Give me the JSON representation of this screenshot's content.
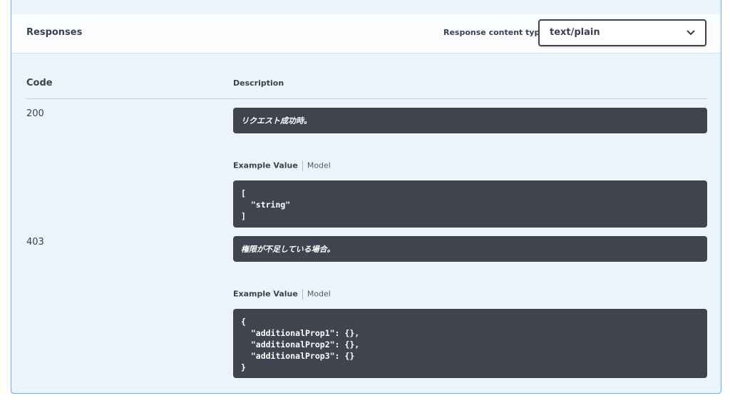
{
  "responses": {
    "title": "Responses",
    "content_type_label": "Response content type",
    "content_type_value": "text/plain"
  },
  "table": {
    "col_code": "Code",
    "col_description": "Description"
  },
  "rows": [
    {
      "code": "200",
      "description": "リクエスト成功時。",
      "tab_example": "Example Value",
      "tab_model": "Model",
      "example": "[\n  \"string\"\n]"
    },
    {
      "code": "403",
      "description": "権限が不足している場合。",
      "tab_example": "Example Value",
      "tab_model": "Model",
      "example": "{\n  \"additionalProp1\": {},\n  \"additionalProp2\": {},\n  \"additionalProp3\": {}\n}"
    }
  ],
  "icons": {
    "select_arrow": "chevron-down-icon"
  },
  "colors": {
    "accent": "#61affe",
    "panel_bg": "#ebf3fb",
    "code_bg": "#41444e"
  }
}
